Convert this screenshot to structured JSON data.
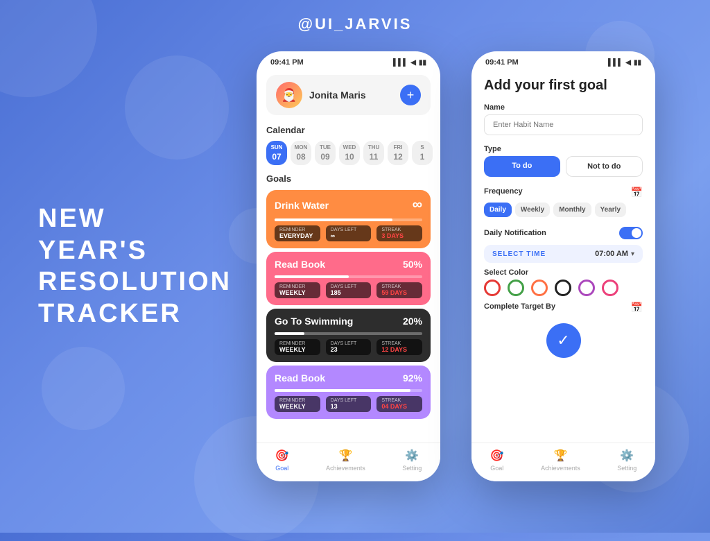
{
  "header": {
    "title": "@UI_JARVIS"
  },
  "left_text": {
    "line1": "NEW",
    "line2": "YEAR'S",
    "line3": "RESOLUTION",
    "line4": "TRACKER"
  },
  "phone_left": {
    "status_time": "09:41 PM",
    "profile_name": "Jonita Maris",
    "add_icon": "+",
    "calendar_label": "Calendar",
    "calendar_days": [
      {
        "name": "SUN",
        "num": "07",
        "active": true
      },
      {
        "name": "MON",
        "num": "08",
        "active": false
      },
      {
        "name": "TUE",
        "num": "09",
        "active": false
      },
      {
        "name": "WED",
        "num": "10",
        "active": false
      },
      {
        "name": "THU",
        "num": "11",
        "active": false
      },
      {
        "name": "FRI",
        "num": "12",
        "active": false
      },
      {
        "name": "S",
        "num": "1",
        "active": false
      }
    ],
    "goals_label": "Goals",
    "goals": [
      {
        "title": "Drink Water",
        "value": "∞",
        "reminder": "EVERYDAY",
        "days_left": "∞",
        "streak": "3 DAYS",
        "card_class": "card-orange",
        "progress": 80
      },
      {
        "title": "Read Book",
        "value": "50%",
        "reminder": "WEEKLY",
        "days_left": "185",
        "streak": "59 DAYS",
        "card_class": "card-salmon",
        "progress": 50
      },
      {
        "title": "Go To Swimming",
        "value": "20%",
        "reminder": "WEEKLY",
        "days_left": "23",
        "streak": "12 DAYS",
        "card_class": "card-dark",
        "progress": 20
      },
      {
        "title": "Read Book",
        "value": "92%",
        "reminder": "WEEKLY",
        "days_left": "13",
        "streak": "04 DAYS",
        "card_class": "card-purple",
        "progress": 92
      }
    ],
    "nav": [
      {
        "label": "Goal",
        "icon": "🎯",
        "active": true
      },
      {
        "label": "Achievements",
        "icon": "🏆",
        "active": false
      },
      {
        "label": "Setting",
        "icon": "⚙️",
        "active": false
      }
    ]
  },
  "phone_right": {
    "status_time": "09:41 PM",
    "form_title": "Add your first goal",
    "name_label": "Name",
    "name_placeholder": "Enter Habit Name",
    "type_label": "Type",
    "type_todo": "To do",
    "type_not_todo": "Not to do",
    "frequency_label": "Frequency",
    "freq_options": [
      "Daily",
      "Weekly",
      "Monthly",
      "Yearly"
    ],
    "freq_active": "Daily",
    "notif_label": "Daily Notification",
    "time_label": "SELECT TIME",
    "time_value": "07:00 AM",
    "color_label": "Select Color",
    "colors": [
      {
        "color": "#e53935",
        "border": "#e53935"
      },
      {
        "color": "#43a047",
        "border": "#43a047"
      },
      {
        "color": "#ff7043",
        "border": "#ff7043"
      },
      {
        "color": "#212121",
        "border": "#212121"
      },
      {
        "color": "#ab47bc",
        "border": "#ab47bc"
      },
      {
        "color": "#ec407a",
        "border": "#ec407a"
      }
    ],
    "target_label": "Complete Target By",
    "submit_icon": "✓",
    "nav": [
      {
        "label": "Goal",
        "icon": "🎯",
        "active": false
      },
      {
        "label": "Achievements",
        "icon": "🏆",
        "active": false
      },
      {
        "label": "Setting",
        "icon": "⚙️",
        "active": false
      }
    ]
  }
}
